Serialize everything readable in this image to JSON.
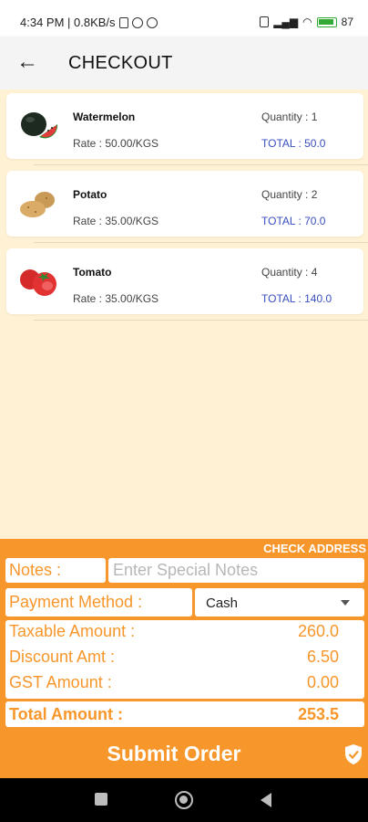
{
  "status_bar": {
    "time_speed": "4:34 PM | 0.8KB/s",
    "battery": "87"
  },
  "header": {
    "title": "CHECKOUT"
  },
  "items": [
    {
      "name": "Watermelon",
      "rate": "Rate : 50.00/KGS",
      "quantity": "Quantity : 1",
      "total": "TOTAL : 50.0",
      "icon": "watermelon-icon"
    },
    {
      "name": "Potato",
      "rate": "Rate : 35.00/KGS",
      "quantity": "Quantity : 2",
      "total": "TOTAL : 70.0",
      "icon": "potato-icon"
    },
    {
      "name": "Tomato",
      "rate": "Rate : 35.00/KGS",
      "quantity": "Quantity : 4",
      "total": "TOTAL : 140.0",
      "icon": "tomato-icon"
    }
  ],
  "footer": {
    "check_address": "CHECK ADDRESS",
    "notes_label": "Notes :",
    "notes_placeholder": "Enter Special Notes",
    "payment_label": "Payment Method :",
    "payment_value": "Cash",
    "taxable_label": "Taxable Amount :",
    "taxable_value": "260.0",
    "discount_label": "Discount Amt :",
    "discount_value": "6.50",
    "gst_label": "GST Amount :",
    "gst_value": "0.00",
    "total_label": "Total Amount :",
    "total_value": "253.5",
    "submit_label": "Submit Order"
  },
  "colors": {
    "accent": "#f7962b",
    "background": "#fff1d3",
    "total_text": "#3a4fbf"
  }
}
